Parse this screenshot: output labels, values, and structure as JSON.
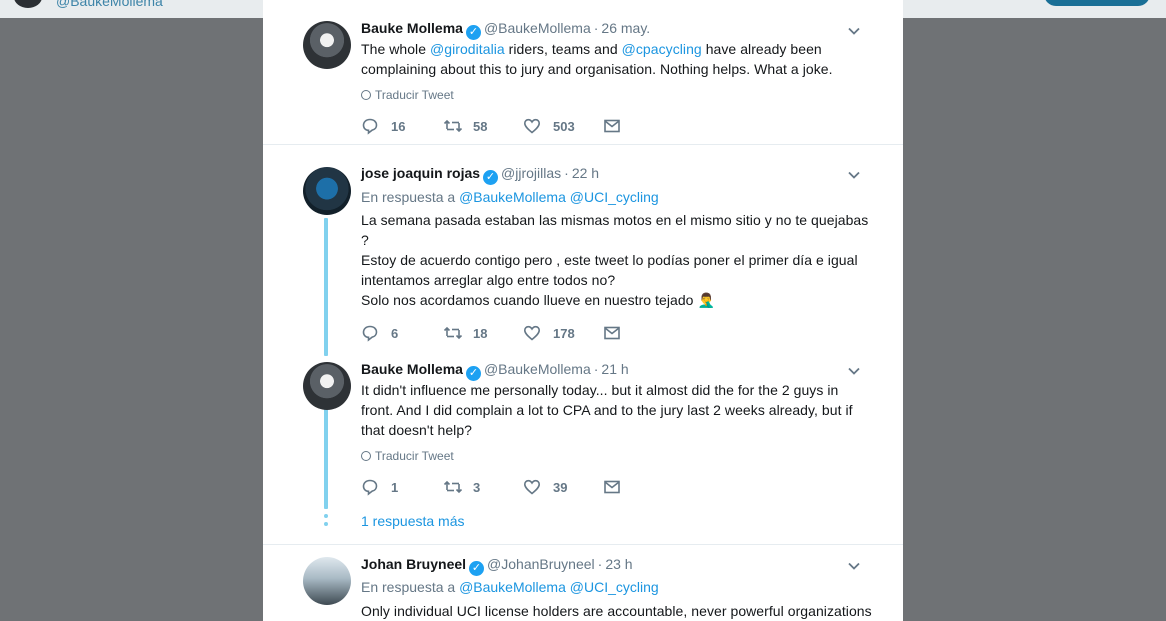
{
  "header": {
    "handle": "@BaukeMollema"
  },
  "ancestor": {
    "name": "Bauke Mollema",
    "handle": "@BaukeMollema",
    "time": "26 may.",
    "body_parts": [
      "The whole ",
      "@giroditalia",
      " riders, teams and ",
      "@cpacycling",
      " have already been"
    ],
    "body_line2": "complaining about this to jury and organisation. Nothing helps. What a joke.",
    "translate": "Traducir Tweet",
    "replies": "16",
    "retweets": "58",
    "likes": "503"
  },
  "reply1": {
    "name": "jose joaquin rojas",
    "handle": "@jjrojillas",
    "time": "22 h",
    "reply_prefix": "En respuesta a",
    "reply_to1": "@BaukeMollema",
    "reply_to2": "@UCI_cycling",
    "lines": [
      "La semana pasada estaban las mismas motos en el mismo sitio y no te quejabas",
      "?",
      "Estoy de acuerdo contigo pero , este tweet lo podías poner el primer día e igual",
      "intentamos arreglar algo entre todos no?",
      "Solo nos acordamos cuando llueve en nuestro tejado"
    ],
    "emoji": "🤦‍♂️",
    "replies": "6",
    "retweets": "18",
    "likes": "178"
  },
  "reply2": {
    "name": "Bauke Mollema",
    "handle": "@BaukeMollema",
    "time": "21 h",
    "lines": [
      "It didn't influence me personally today... but it almost did the for the 2 guys in",
      "front. And I did complain a lot to CPA and to the jury last 2 weeks already, but if",
      "that doesn't help?"
    ],
    "translate": "Traducir Tweet",
    "replies": "1",
    "retweets": "3",
    "likes": "39",
    "more": "1 respuesta más"
  },
  "reply3": {
    "name": "Johan Bruyneel",
    "handle": "@JohanBruyneel",
    "time": "23 h",
    "reply_prefix": "En respuesta a",
    "reply_to1": "@BaukeMollema",
    "reply_to2": "@UCI_cycling",
    "line1": "Only individual UCI license holders are accountable, never powerful organizations"
  },
  "colors": {
    "link": "#1b95e0",
    "verified": "#1da1f2",
    "thread": "#81d1ee"
  }
}
